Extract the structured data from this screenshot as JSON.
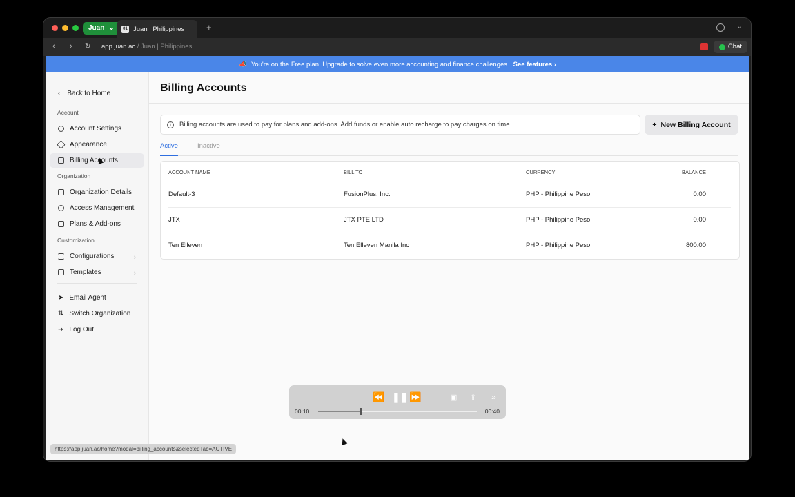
{
  "browser": {
    "profile_label": "Juan",
    "tab_title": "Juan | Philippines",
    "tab_favicon": "01",
    "new_tab_label": "+",
    "url_host": "app.juan.ac",
    "url_path": " / Juan | Philippines",
    "chat_label": "Chat"
  },
  "banner": {
    "text": "You're on the Free plan. Upgrade to solve even more accounting and finance challenges.",
    "link": "See features"
  },
  "sidebar": {
    "back_label": "Back to Home",
    "sections": [
      {
        "heading": "Account"
      },
      {
        "heading": "Organization"
      },
      {
        "heading": "Customization"
      }
    ],
    "items": [
      {
        "label": "Account Settings"
      },
      {
        "label": "Appearance"
      },
      {
        "label": "Billing Accounts"
      },
      {
        "label": "Organization Details"
      },
      {
        "label": "Access Management"
      },
      {
        "label": "Plans & Add-ons"
      },
      {
        "label": "Configurations"
      },
      {
        "label": "Templates"
      },
      {
        "label": "Email Agent"
      },
      {
        "label": "Switch Organization"
      },
      {
        "label": "Log Out"
      }
    ]
  },
  "main": {
    "title": "Billing Accounts",
    "info_text": "Billing accounts are used to pay for plans and add-ons. Add funds or enable auto recharge to pay charges on time.",
    "new_button": "New Billing Account",
    "tabs": [
      {
        "label": "Active"
      },
      {
        "label": "Inactive"
      }
    ],
    "table": {
      "headers": [
        "ACCOUNT NAME",
        "BILL TO",
        "CURRENCY",
        "BALANCE"
      ],
      "rows": [
        {
          "name": "Default-3",
          "bill_to": "FusionPlus, Inc.",
          "currency": "PHP - Philippine Peso",
          "balance": "0.00"
        },
        {
          "name": "JTX",
          "bill_to": "JTX PTE LTD",
          "currency": "PHP - Philippine Peso",
          "balance": "0.00"
        },
        {
          "name": "Ten Elleven",
          "bill_to": "Ten Elleven Manila Inc",
          "currency": "PHP - Philippine Peso",
          "balance": "800.00"
        }
      ]
    }
  },
  "player": {
    "current_time": "00:10",
    "duration": "00:40",
    "progress": 0.27
  },
  "status_url": "https://app.juan.ac/home?modal=billing_accounts&selectedTab=ACTIVE",
  "colors": {
    "banner": "#4a86e8",
    "accent": "#2f6fe0",
    "profile": "#1f8f3a"
  }
}
